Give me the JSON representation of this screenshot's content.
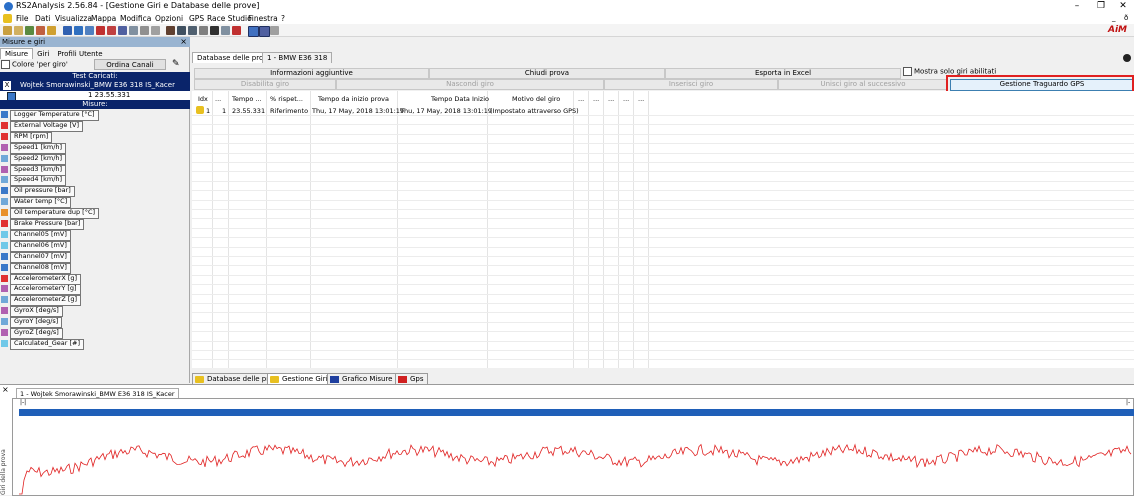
{
  "window": {
    "title": "RS2Analysis 2.56.84 - [Gestione Giri e Database delle prove]",
    "controls": [
      "–",
      "❐",
      "✕"
    ],
    "mdi_controls": [
      "_",
      "ð"
    ]
  },
  "menu": [
    "File",
    "Dati",
    "Visualizza",
    "Mappa",
    "Modifica",
    "Opzioni",
    "GPS",
    "Race Studio",
    "Finestra",
    "?"
  ],
  "brand": "AiM",
  "left_panel": {
    "title": "Misure e giri",
    "close": "×",
    "tabs": [
      "Misure",
      "Giri",
      "Profili Utente"
    ],
    "colore_per_giro": "Colore 'per giro'",
    "ordina_canali": "Ordina Canali",
    "test_caricati": "Test Caricati:",
    "test_row": {
      "x": "X",
      "name": "Wojtek Smorawinski_BMW E36 318 IS_Kacer"
    },
    "lap_row": "1 23.55.331",
    "misure": "Misure:",
    "channels": [
      {
        "label": "Logger Temperature   [°C]",
        "color": "#3a78c8"
      },
      {
        "label": "External Voltage   [V]",
        "color": "#e03030"
      },
      {
        "label": "RPM   [rpm]",
        "color": "#e03030"
      },
      {
        "label": "Speed1   [km/h]",
        "color": "#b060b0"
      },
      {
        "label": "Speed2   [km/h]",
        "color": "#70a8d8"
      },
      {
        "label": "Speed3   [km/h]",
        "color": "#b060b0"
      },
      {
        "label": "Speed4   [km/h]",
        "color": "#70a8d8"
      },
      {
        "label": "Oil pressure   [bar]",
        "color": "#3a78c8"
      },
      {
        "label": "Water temp   [°C]",
        "color": "#70a8d8"
      },
      {
        "label": "Oil temperature dup   [°C]",
        "color": "#e8902a"
      },
      {
        "label": "Brake Pressure   [bar]",
        "color": "#e03030"
      },
      {
        "label": "Channel05   [mV]",
        "color": "#70c8e8"
      },
      {
        "label": "Channel06   [mV]",
        "color": "#70c8e8"
      },
      {
        "label": "Channel07   [mV]",
        "color": "#3a78c8"
      },
      {
        "label": "Channel08   [mV]",
        "color": "#3a78c8"
      },
      {
        "label": "AccelerometerX   [g]",
        "color": "#e03030"
      },
      {
        "label": "AccelerometerY   [g]",
        "color": "#b060b0"
      },
      {
        "label": "AccelerometerZ   [g]",
        "color": "#70a8d8"
      },
      {
        "label": "GyroX   [deg/s]",
        "color": "#b060b0"
      },
      {
        "label": "GyroY   [deg/s]",
        "color": "#70a8d8"
      },
      {
        "label": "GyroZ   [deg/s]",
        "color": "#b060b0"
      },
      {
        "label": "Calculated_Gear   [#]",
        "color": "#70c8e8"
      }
    ]
  },
  "right_panel": {
    "tabs": [
      "Database delle prove",
      "1 - BMW E36 318"
    ],
    "row1_buttons": [
      "Informazioni aggiuntive",
      "Chiudi prova",
      "Esporta in Excel"
    ],
    "mostra_solo": "Mostra solo giri abilitati",
    "row2_buttons": [
      "Disabilita giro",
      "Nascondi giro",
      "Inserisci giro",
      "Unisci giro al successivo",
      "Gestione Traguardo GPS"
    ],
    "headers": [
      "Idx",
      "...",
      "Tempo ...",
      "% rispet...",
      "Tempo da inizio prova",
      "Tempo Data Inizio",
      "Motivo del giro",
      "...",
      "...",
      "...",
      "...",
      "..."
    ],
    "rows": [
      [
        "1",
        "1",
        "23.55.331",
        "Riferimento",
        "Thu, 17 May, 2018  13:01:19",
        "Thu, 17 May, 2018  13:01:19",
        "(Impostato attraverso GPS)"
      ]
    ]
  },
  "bottom_tabs": [
    "Database delle prove",
    "Gestione Giri",
    "Grafico Misure",
    "Gps"
  ],
  "graph": {
    "close": "×",
    "tab": "1 - Wojtek Smorawinski_BMW E36 318 IS_Kacer",
    "left_marker": "|-|",
    "right_marker": "|-",
    "vertical_label": "Giri della prova",
    "trace_color": "#e02020",
    "bar_color": "#1f5fb8"
  }
}
